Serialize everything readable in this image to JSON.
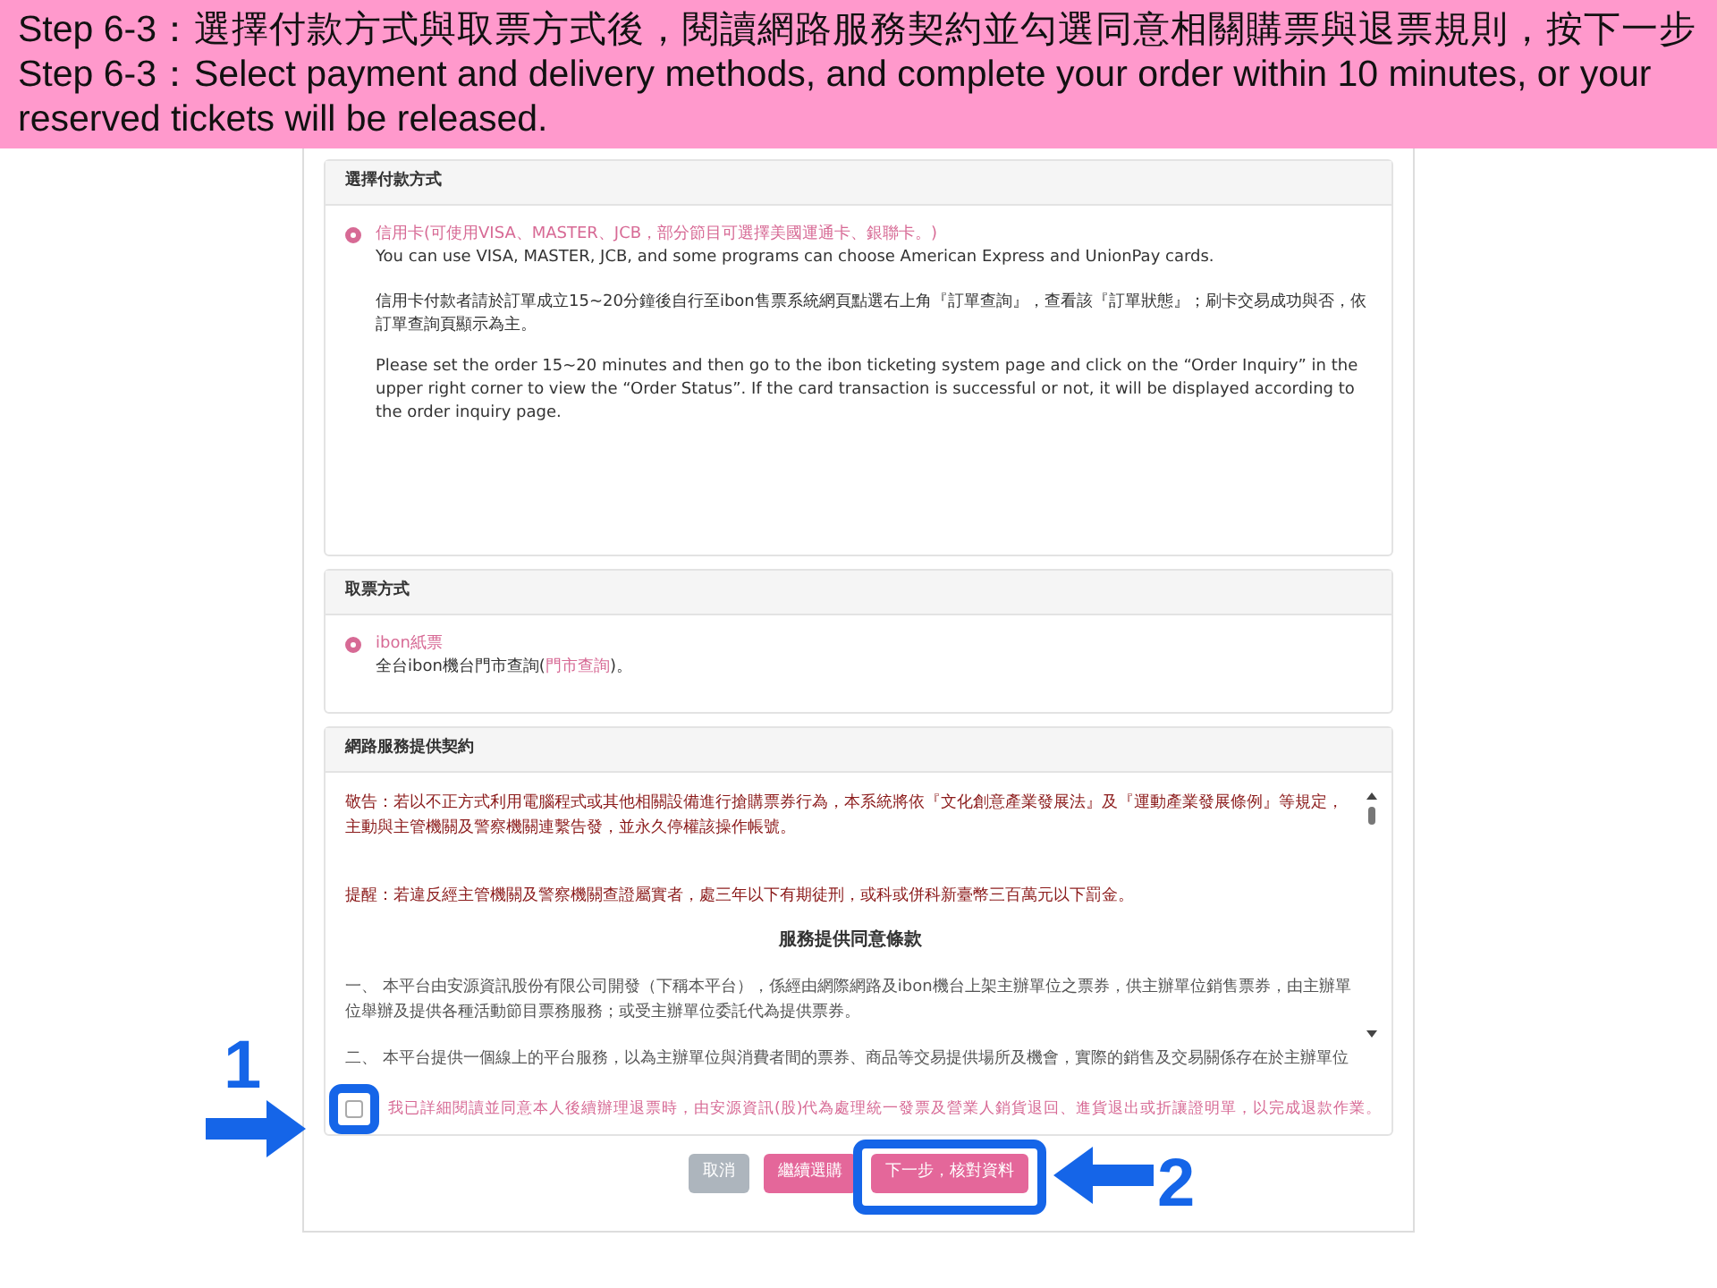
{
  "banner": {
    "lines": [
      "Step 6-3：選擇付款方式與取票方式後，閱讀網路服務契約並勾選同意相關購票與退票規則，按下一步",
      "Step 6-3：Select payment and delivery methods, and complete your order within 10 minutes, or your reserved tickets will be released."
    ]
  },
  "payment": {
    "title": "選擇付款方式",
    "options": [
      {
        "label": "信用卡(可使用VISA、MASTER、JCB，部分節目可選擇美國運通卡、銀聯卡。)",
        "selected": true,
        "paragraphs": [
          "You can use VISA, MASTER, JCB, and some programs can choose American Express and UnionPay cards.",
          "信用卡付款者請於訂單成立15~20分鐘後自行至ibon售票系統網頁點選右上角『訂單查詢』，查看該『訂單狀態』；刷卡交易成功與否，依訂單查詢頁顯示為主。",
          "Please set the order 15~20 minutes and then go to the ibon ticketing system page and click on the “Order Inquiry” in the upper right corner to view the “Order Status”. If the card transaction is successful or not, it will be displayed according to the order inquiry page."
        ]
      }
    ]
  },
  "delivery": {
    "title": "取票方式",
    "options": [
      {
        "label": "ibon紙票",
        "selected": true,
        "note_before": "全台ibon機台門市查詢(",
        "link": "門市查詢",
        "note_after": ")。"
      }
    ]
  },
  "contract": {
    "title": "網路服務提供契約",
    "warning": "敬告：若以不正方式利用電腦程式或其他相關設備進行搶購票券行為，本系統將依『文化創意產業發展法』及『運動產業發展條例』等規定，主動與主管機關及警察機關連繫告發，並永久停權該操作帳號。",
    "reminder": "提醒：若違反經主管機關及警察機關查證屬實者，處三年以下有期徒刑，或科或併科新臺幣三百萬元以下罰金。",
    "heading": "服務提供同意條款",
    "clauses": [
      "一、 本平台由安源資訊股份有限公司開發（下稱本平台），係經由網際網路及ibon機台上架主辦單位之票券，供主辦單位銷售票券，由主辦單位舉辦及提供各種活動節目票務服務；或受主辦單位委託代為提供票券。",
      "二、 本平台提供一個線上的平台服務，以為主辦單位與消費者間的票券、商品等交易提供場所及機會，實際的銷售及交易關係存在於主辦單位"
    ],
    "agree": {
      "label": "我已詳細閱讀並同意本人後續辦理退票時，由安源資訊(股)代為處理統一發票及營業人銷貨退回、進貨退出或折讓證明單，以完成退款作業。",
      "checked": false
    }
  },
  "buttons": [
    {
      "label": "取消",
      "kind": "cancel"
    },
    {
      "label": "繼續選購",
      "kind": "continue"
    },
    {
      "label": "下一步，核對資料",
      "kind": "next"
    }
  ],
  "annotations": [
    {
      "number": "1"
    },
    {
      "number": "2"
    }
  ]
}
